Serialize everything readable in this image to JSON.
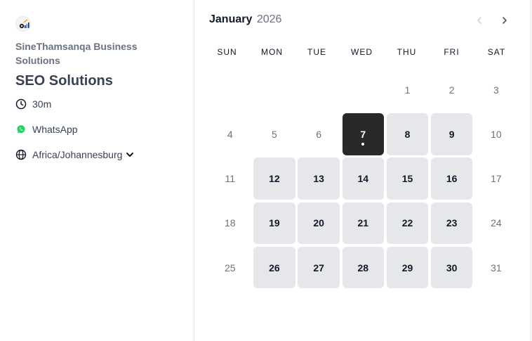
{
  "profile": {
    "org_name": "SineThamsanqa Business Solutions",
    "event_title": "SEO Solutions",
    "duration": "30m",
    "location": "WhatsApp",
    "timezone": "Africa/Johannesburg"
  },
  "calendar": {
    "month": "January",
    "year": "2026",
    "weekdays": [
      "SUN",
      "MON",
      "TUE",
      "WED",
      "THU",
      "FRI",
      "SAT"
    ],
    "leading_blanks": 4,
    "days": [
      {
        "n": "1",
        "state": "disabled"
      },
      {
        "n": "2",
        "state": "disabled"
      },
      {
        "n": "3",
        "state": "disabled"
      },
      {
        "n": "4",
        "state": "disabled"
      },
      {
        "n": "5",
        "state": "disabled"
      },
      {
        "n": "6",
        "state": "disabled"
      },
      {
        "n": "7",
        "state": "selected"
      },
      {
        "n": "8",
        "state": "available"
      },
      {
        "n": "9",
        "state": "available"
      },
      {
        "n": "10",
        "state": "disabled"
      },
      {
        "n": "11",
        "state": "disabled"
      },
      {
        "n": "12",
        "state": "available"
      },
      {
        "n": "13",
        "state": "available"
      },
      {
        "n": "14",
        "state": "available"
      },
      {
        "n": "15",
        "state": "available"
      },
      {
        "n": "16",
        "state": "available"
      },
      {
        "n": "17",
        "state": "disabled"
      },
      {
        "n": "18",
        "state": "disabled"
      },
      {
        "n": "19",
        "state": "available"
      },
      {
        "n": "20",
        "state": "available"
      },
      {
        "n": "21",
        "state": "available"
      },
      {
        "n": "22",
        "state": "available"
      },
      {
        "n": "23",
        "state": "available"
      },
      {
        "n": "24",
        "state": "disabled"
      },
      {
        "n": "25",
        "state": "disabled"
      },
      {
        "n": "26",
        "state": "available"
      },
      {
        "n": "27",
        "state": "available"
      },
      {
        "n": "28",
        "state": "available"
      },
      {
        "n": "29",
        "state": "available"
      },
      {
        "n": "30",
        "state": "available"
      },
      {
        "n": "31",
        "state": "disabled"
      }
    ]
  },
  "icons": {
    "duration": "clock-icon",
    "location": "whatsapp-icon",
    "timezone": "globe-icon",
    "prev": "chevron-left-icon",
    "next": "chevron-right-icon"
  },
  "colors": {
    "selected": "#292929",
    "available": "#e5e7eb",
    "whatsapp": "#25d366"
  }
}
